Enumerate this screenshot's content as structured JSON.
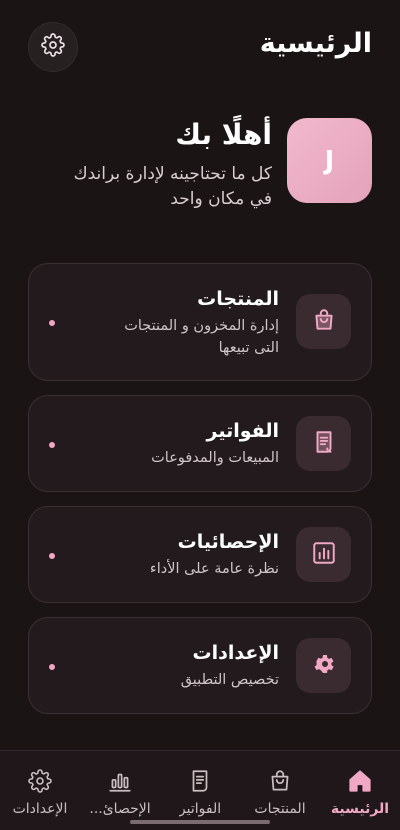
{
  "header": {
    "title": "الرئيسية",
    "settings_icon": "gear-icon"
  },
  "welcome": {
    "avatar_letter": "J",
    "title": "أهلًا بك",
    "subtitle_line1": "كل ما تحتاجينه لإدارة براندك",
    "subtitle_line2": "في مكان واحد"
  },
  "cards": [
    {
      "icon": "shopping-bag-icon",
      "title": "المنتجات",
      "desc_line1": "إدارة المخزون و المنتجات",
      "desc_line2": "التى تبيعها"
    },
    {
      "icon": "receipt-icon",
      "title": "الفواتير",
      "desc_line1": "المبيعات والمدفوعات"
    },
    {
      "icon": "bar-chart-icon",
      "title": "الإحصائيات",
      "desc_line1": "نظرة عامة على الأداء"
    },
    {
      "icon": "gear-icon",
      "title": "الإعدادات",
      "desc_line1": "تخصيص التطبيق"
    }
  ],
  "nav": [
    {
      "icon": "home-icon",
      "label": "الرئيسية",
      "active": true
    },
    {
      "icon": "shopping-bag-icon",
      "label": "المنتجات"
    },
    {
      "icon": "receipt-icon",
      "label": "الفواتير"
    },
    {
      "icon": "bar-chart-icon",
      "label": "الإحصائ..."
    },
    {
      "icon": "gear-icon",
      "label": "الإعدادات"
    }
  ],
  "colors": {
    "background": "#1b1415",
    "accent": "#f0a8c4",
    "card": "#221a1c"
  }
}
